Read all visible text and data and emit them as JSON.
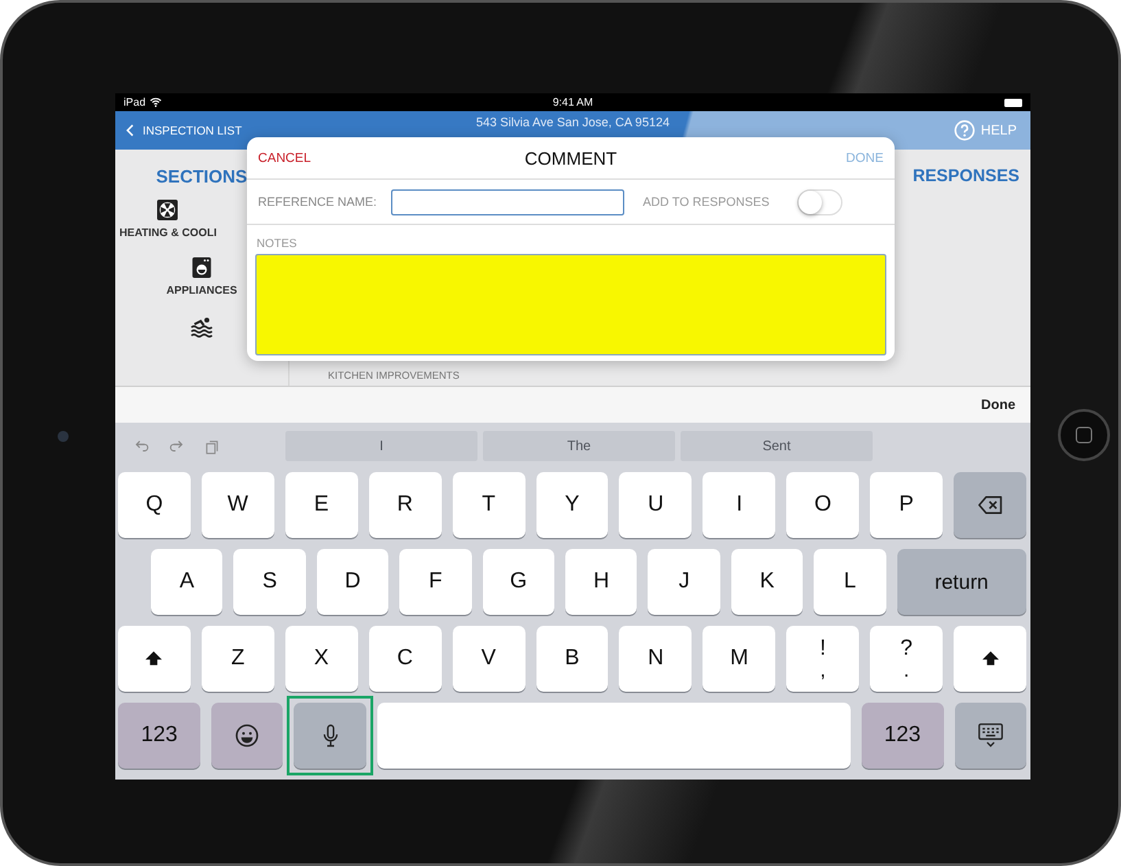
{
  "status_bar": {
    "carrier": "iPad",
    "time": "9:41 AM"
  },
  "nav_bar": {
    "back": "INSPECTION LIST",
    "title": "543 Silvia Ave San Jose, CA 95124",
    "help": "HELP"
  },
  "sections": {
    "heading": "SECTIONS",
    "items": [
      {
        "kind": "fan",
        "label": "HEATING & COOLI"
      },
      {
        "kind": "washer",
        "label": "APPLIANCES"
      },
      {
        "kind": "swimmer"
      }
    ]
  },
  "responses": {
    "heading": "RESPONSES",
    "items": [
      "KITCHEN IMPROVEMENTS"
    ]
  },
  "modal": {
    "cancel": "CANCEL",
    "title": "COMMENT",
    "done": "DONE",
    "reference_label": "REFERENCE NAME:",
    "add_label": "ADD TO RESPONSES",
    "add_to_responses": false,
    "notes_label": "NOTES"
  },
  "accessory_bar": {
    "done": "Done"
  },
  "keyboard": {
    "suggestions": [
      "I",
      "The",
      "Sent"
    ],
    "key_rows": [
      {
        "keys": [
          {
            "kind": "letter",
            "label": "Q"
          },
          {
            "kind": "letter",
            "label": "W"
          },
          {
            "kind": "letter",
            "label": "E"
          },
          {
            "kind": "letter",
            "label": "R"
          },
          {
            "kind": "letter",
            "label": "T"
          },
          {
            "kind": "letter",
            "label": "Y"
          },
          {
            "kind": "letter",
            "label": "U"
          },
          {
            "kind": "letter",
            "label": "I"
          },
          {
            "kind": "letter",
            "label": "O"
          },
          {
            "kind": "letter",
            "label": "P"
          },
          {
            "kind": "backspace"
          }
        ]
      },
      {
        "keys": [
          {
            "kind": "letter",
            "label": "A"
          },
          {
            "kind": "letter",
            "label": "S"
          },
          {
            "kind": "letter",
            "label": "D"
          },
          {
            "kind": "letter",
            "label": "F"
          },
          {
            "kind": "letter",
            "label": "G"
          },
          {
            "kind": "letter",
            "label": "H"
          },
          {
            "kind": "letter",
            "label": "J"
          },
          {
            "kind": "letter",
            "label": "K"
          },
          {
            "kind": "letter",
            "label": "L"
          },
          {
            "kind": "return",
            "label": "return"
          }
        ]
      },
      {
        "keys": [
          {
            "kind": "shift"
          },
          {
            "kind": "letter",
            "label": "Z"
          },
          {
            "kind": "letter",
            "label": "X"
          },
          {
            "kind": "letter",
            "label": "C"
          },
          {
            "kind": "letter",
            "label": "V"
          },
          {
            "kind": "letter",
            "label": "B"
          },
          {
            "kind": "letter",
            "label": "N"
          },
          {
            "kind": "letter",
            "label": "M"
          },
          {
            "kind": "punct",
            "label": "!",
            "sublabel": ","
          },
          {
            "kind": "punct",
            "label": "?",
            "sublabel": "."
          },
          {
            "kind": "shift"
          }
        ]
      },
      {
        "keys": [
          {
            "kind": "numbers",
            "label": "123",
            "highlighted": false
          },
          {
            "kind": "emoji",
            "highlighted": false
          },
          {
            "kind": "mic",
            "highlighted": true
          },
          {
            "kind": "space",
            "highlighted": false
          },
          {
            "kind": "numbers",
            "label": "123",
            "highlighted": false
          },
          {
            "kind": "hide",
            "highlighted": false
          }
        ]
      }
    ]
  }
}
